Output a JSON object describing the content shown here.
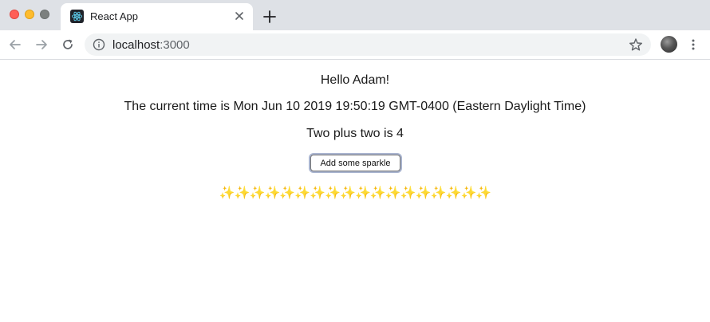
{
  "browser": {
    "tab": {
      "title": "React App",
      "favicon": "react-logo-icon"
    },
    "new_tab_icon": "plus-icon",
    "address_bar": {
      "host": "localhost",
      "port": ":3000",
      "info_icon": "info-icon",
      "bookmark_icon": "star-icon"
    },
    "nav": {
      "back_icon": "arrow-left-icon",
      "forward_icon": "arrow-right-icon",
      "reload_icon": "reload-icon"
    },
    "menu_icon": "kebab-menu-icon",
    "colors": {
      "tabstrip": "#dee1e6",
      "omnibox": "#f1f3f4",
      "close": "#ff5f57",
      "minimize": "#febc2e",
      "maximize": "#7c807f"
    }
  },
  "app": {
    "greeting": "Hello Adam!",
    "time_text": "The current time is Mon Jun 10 2019 19:50:19 GMT-0400 (Eastern Daylight Time)",
    "math_text": "Two plus two is 4",
    "button_label": "Add some sparkle",
    "sparkles": "✨✨✨✨✨✨✨✨✨✨✨✨✨✨✨✨✨✨"
  }
}
